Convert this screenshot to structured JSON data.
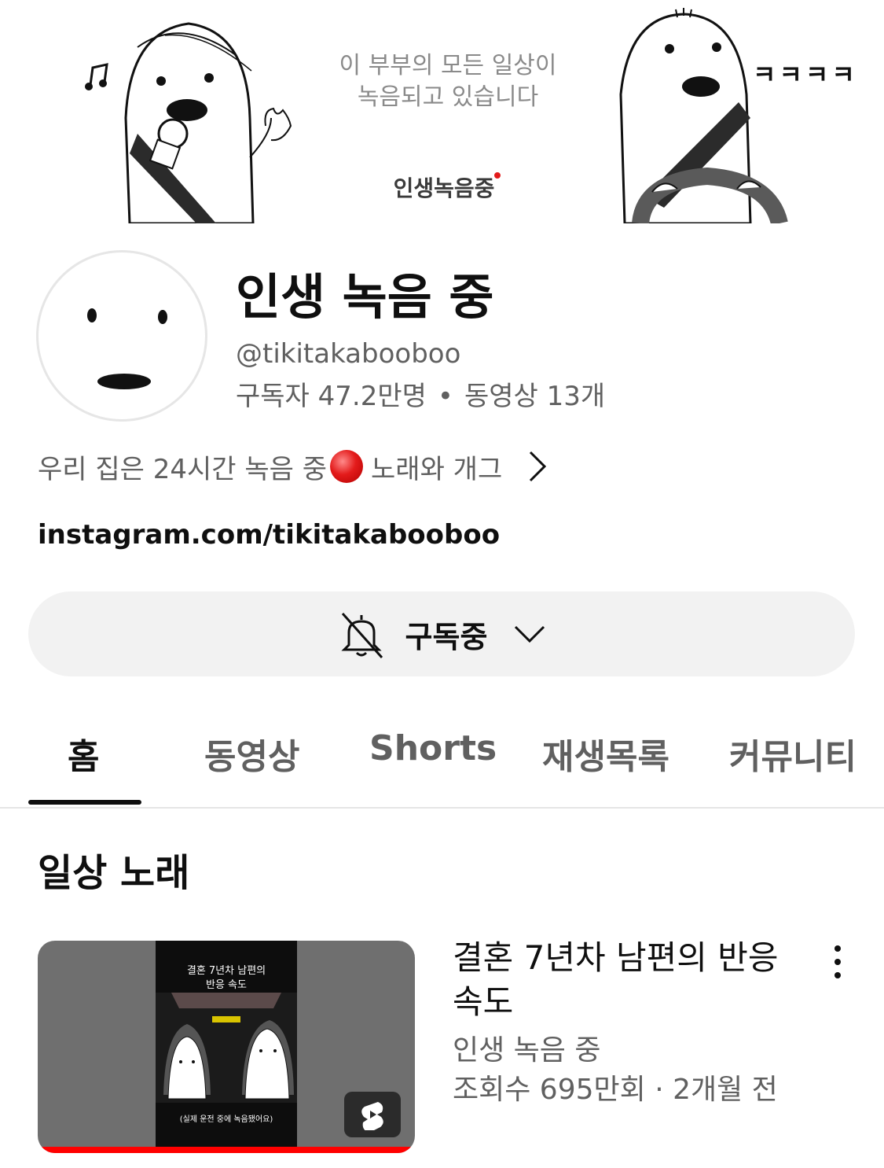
{
  "banner": {
    "caption_line1": "이 부부의 모든 일상이",
    "caption_line2": "녹음되고 있습니다",
    "logo_text": "인생녹음중",
    "laugh_text": "ㅋㅋㅋㅋ",
    "music_icon": "music-note-icon"
  },
  "channel": {
    "name": "인생 녹음 중",
    "handle": "@tikitakabooboo",
    "subscribers": "구독자 47.2만명",
    "dot": "•",
    "videos": "동영상 13개",
    "description": "우리 집은 24시간 녹음 중",
    "description_tail": "노래와 개그",
    "link": "instagram.com/tikitakabooboo"
  },
  "subscribe": {
    "label": "구독중",
    "bell_icon": "bell-off-icon",
    "chevron_icon": "chevron-down-icon"
  },
  "tabs": [
    {
      "label": "홈",
      "active": true
    },
    {
      "label": "동영상",
      "active": false
    },
    {
      "label": "Shorts",
      "active": false
    },
    {
      "label": "재생목록",
      "active": false
    },
    {
      "label": "커뮤니티",
      "active": false
    }
  ],
  "section": {
    "title": "일상 노래"
  },
  "video": {
    "thumbnail_caption_line1": "결혼 7년차 남편의",
    "thumbnail_caption_line2": "반응 속도",
    "thumbnail_caption_bottom": "(실제 운전 중에 녹음됐어요)",
    "title": "결혼 7년차 남편의 반응속도",
    "channel": "인생 녹음 중",
    "meta": "조회수 695만회 · 2개월 전",
    "progress": 1.0,
    "badge_icon": "shorts-icon",
    "menu_icon": "more-vertical-icon"
  },
  "colors": {
    "accent_red": "#ff0000",
    "text_primary": "#0f0f0f",
    "text_secondary": "#606060",
    "pill_bg": "#f2f2f2"
  }
}
